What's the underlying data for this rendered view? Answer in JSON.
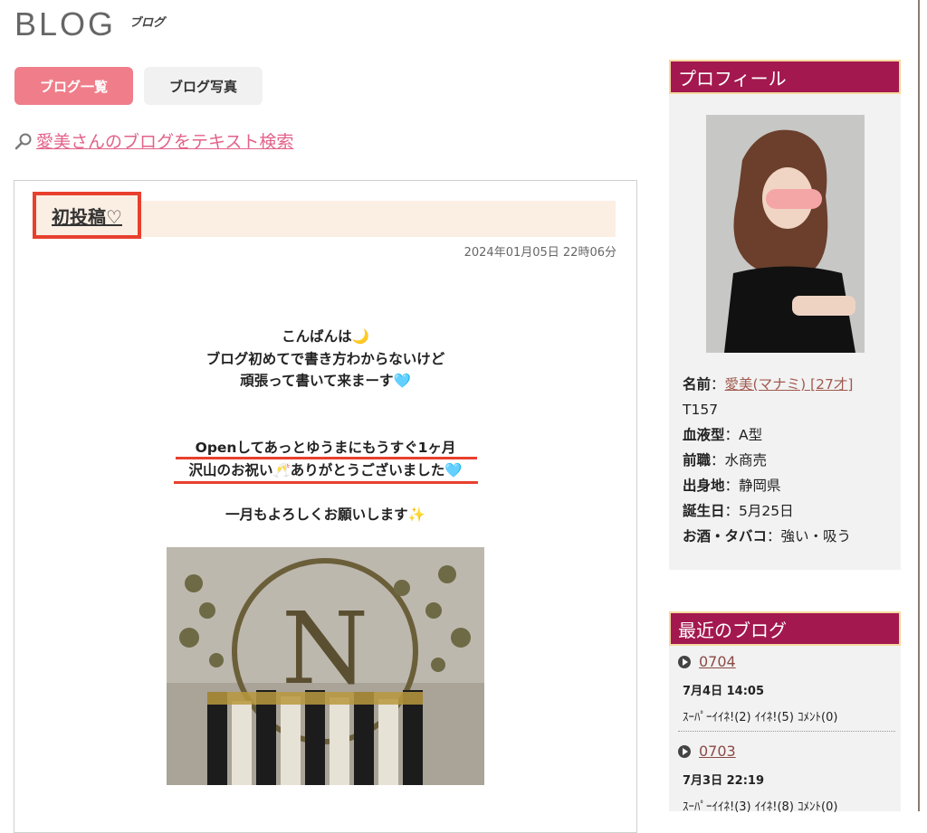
{
  "header": {
    "title": "BLOG",
    "subtitle": "ブログ"
  },
  "tabs": [
    {
      "label": "ブログ一覧",
      "active": true
    },
    {
      "label": "ブログ写真",
      "active": false
    }
  ],
  "search": {
    "link_text": "愛美さんのブログをテキスト検索",
    "icon": "magnifier-icon"
  },
  "post": {
    "title": "初投稿♡",
    "date": "2024年01月05日 22時06分",
    "lines": [
      "こんばんは🌙",
      "ブログ初めてで書き方わからないけど",
      "頑張って書いて来まーす🩵",
      "Openしてあっとゆうまにもうすぐ1ヶ月",
      "沢山のお祝い🥂ありがとうございました🩵",
      "一月もよろしくお願いします✨"
    ]
  },
  "profile": {
    "heading": "プロフィール",
    "name_label": "名前",
    "name_value": "愛美(マナミ) [27才]",
    "height": "T157",
    "rows": [
      {
        "label": "血液型",
        "value": "A型"
      },
      {
        "label": "前職",
        "value": "水商売"
      },
      {
        "label": "出身地",
        "value": "静岡県"
      },
      {
        "label": "誕生日",
        "value": "5月25日"
      },
      {
        "label": "お酒・タバコ",
        "value": "強い・吸う"
      }
    ]
  },
  "recent": {
    "heading": "最近のブログ",
    "items": [
      {
        "title": "0704",
        "time": "7月4日 14:05",
        "stats": "ｽｰﾊﾟｰｲｲﾈ!(2) ｲｲﾈ!(5) ｺﾒﾝﾄ(0)"
      },
      {
        "title": "0703",
        "time": "7月3日 22:19",
        "stats": "ｽｰﾊﾟｰｲｲﾈ!(3) ｲｲﾈ!(8) ｺﾒﾝﾄ(0)"
      }
    ]
  },
  "colors": {
    "accent": "#a3184f",
    "tab_active": "#ef7e8a",
    "link": "#e2628a",
    "highlight": "#e8402e"
  }
}
